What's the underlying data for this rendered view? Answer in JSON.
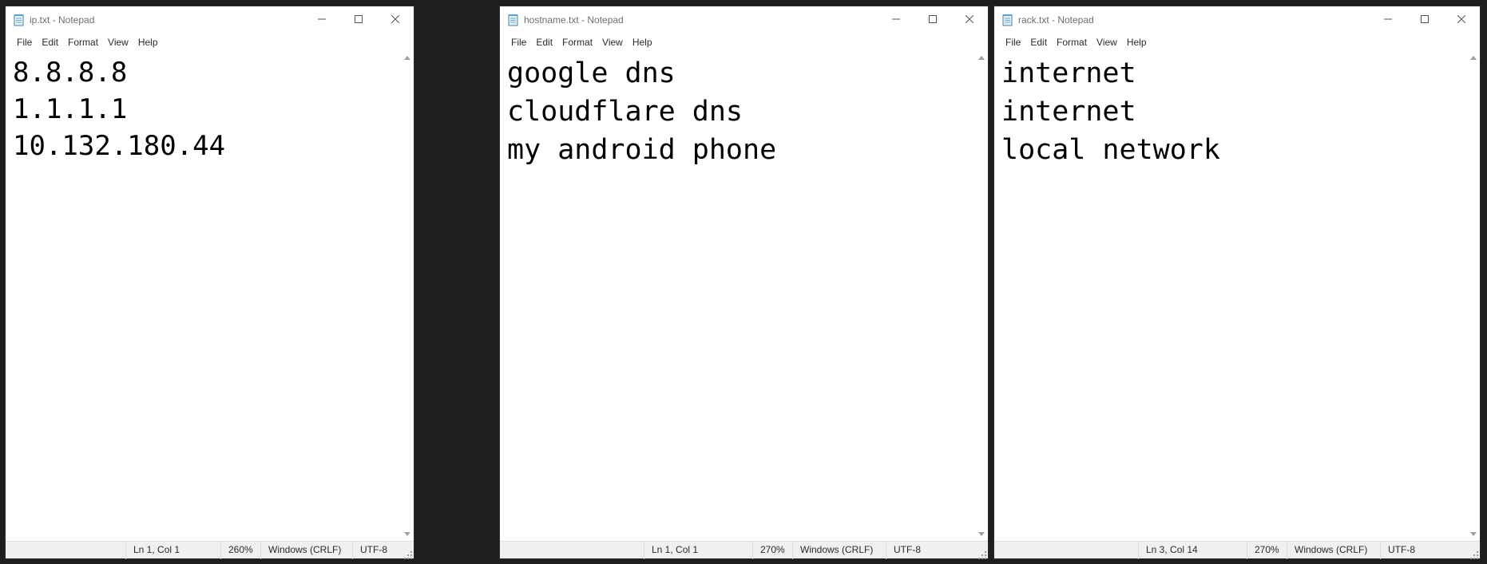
{
  "windows": [
    {
      "title": "ip.txt - Notepad",
      "menu": [
        "File",
        "Edit",
        "Format",
        "View",
        "Help"
      ],
      "lines": [
        "8.8.8.8",
        "1.1.1.1",
        "10.132.180.44"
      ],
      "status": {
        "position": "Ln 1, Col 1",
        "zoom": "260%",
        "line_ending": "Windows (CRLF)",
        "encoding": "UTF-8"
      }
    },
    {
      "title": "hostname.txt - Notepad",
      "menu": [
        "File",
        "Edit",
        "Format",
        "View",
        "Help"
      ],
      "lines": [
        "google dns",
        "cloudflare dns",
        "my android phone"
      ],
      "status": {
        "position": "Ln 1, Col 1",
        "zoom": "270%",
        "line_ending": "Windows (CRLF)",
        "encoding": "UTF-8"
      }
    },
    {
      "title": "rack.txt - Notepad",
      "menu": [
        "File",
        "Edit",
        "Format",
        "View",
        "Help"
      ],
      "lines": [
        "internet",
        "internet",
        "local network"
      ],
      "status": {
        "position": "Ln 3, Col 14",
        "zoom": "270%",
        "line_ending": "Windows (CRLF)",
        "encoding": "UTF-8"
      }
    }
  ],
  "icons": {
    "app": "notepad-icon",
    "minimize": "minimize-icon",
    "maximize": "maximize-icon",
    "close": "close-icon",
    "scroll_up": "scroll-up-arrow-icon",
    "scroll_down": "scroll-down-arrow-icon",
    "grip": "resize-grip-icon"
  },
  "colors": {
    "desktop_background": "#1e1e1e",
    "window_background": "#ffffff",
    "statusbar_background": "#f0f0f0",
    "title_text": "#6e6e6e",
    "editor_text": "#000000"
  }
}
